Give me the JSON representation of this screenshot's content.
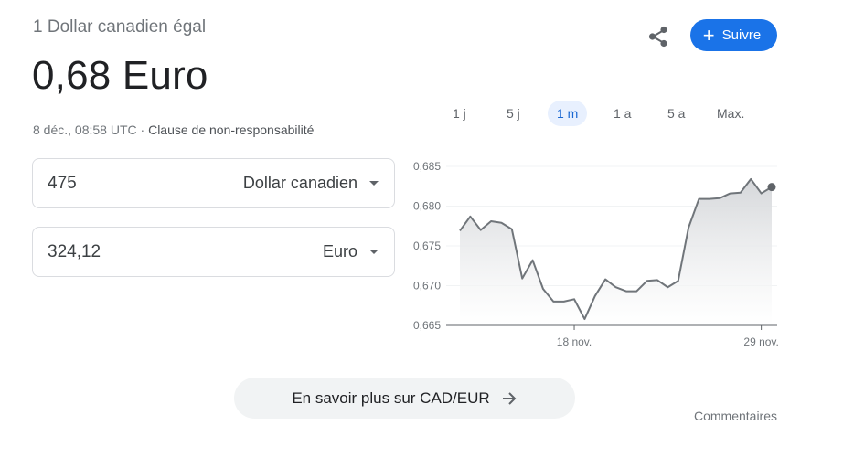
{
  "header": {
    "subtitle": "1 Dollar canadien égal",
    "result": "0,68 Euro",
    "timestamp": "8 déc., 08:58 UTC",
    "separator": " · ",
    "disclaimer": "Clause de non-responsabilité"
  },
  "actions": {
    "share_icon": "share-icon",
    "follow_label": "Suivre",
    "follow_icon": "+"
  },
  "converter": {
    "from": {
      "value": "475",
      "currency": "Dollar canadien"
    },
    "to": {
      "value": "324,12",
      "currency": "Euro"
    }
  },
  "ranges": [
    {
      "label": "1 j",
      "active": false
    },
    {
      "label": "5 j",
      "active": false
    },
    {
      "label": "1 m",
      "active": true
    },
    {
      "label": "1 a",
      "active": false
    },
    {
      "label": "5 a",
      "active": false
    },
    {
      "label": "Max.",
      "active": false
    }
  ],
  "colors": {
    "accent": "#1a73e8",
    "line": "#70757a",
    "area_top": "#d5d7da"
  },
  "chart_data": {
    "type": "area",
    "ylim": [
      0.665,
      0.685
    ],
    "yticks": [
      0.665,
      0.67,
      0.675,
      0.68,
      0.685
    ],
    "ytick_labels": [
      "0,665",
      "0,670",
      "0,675",
      "0,680",
      "0,685"
    ],
    "xticks": [
      {
        "label": "18 nov.",
        "index": 11
      },
      {
        "label": "29 nov.",
        "index": 29
      }
    ],
    "values": [
      0.6769,
      0.6787,
      0.677,
      0.6781,
      0.6779,
      0.6771,
      0.6709,
      0.6732,
      0.6696,
      0.668,
      0.668,
      0.6683,
      0.6658,
      0.6687,
      0.6708,
      0.6698,
      0.6693,
      0.6693,
      0.6706,
      0.6707,
      0.6698,
      0.6706,
      0.6773,
      0.6809,
      0.6809,
      0.681,
      0.6816,
      0.6817,
      0.6834,
      0.6816,
      0.6824
    ]
  },
  "footer": {
    "more_label": "En savoir plus sur CAD/EUR",
    "feedback_label": "Commentaires"
  }
}
